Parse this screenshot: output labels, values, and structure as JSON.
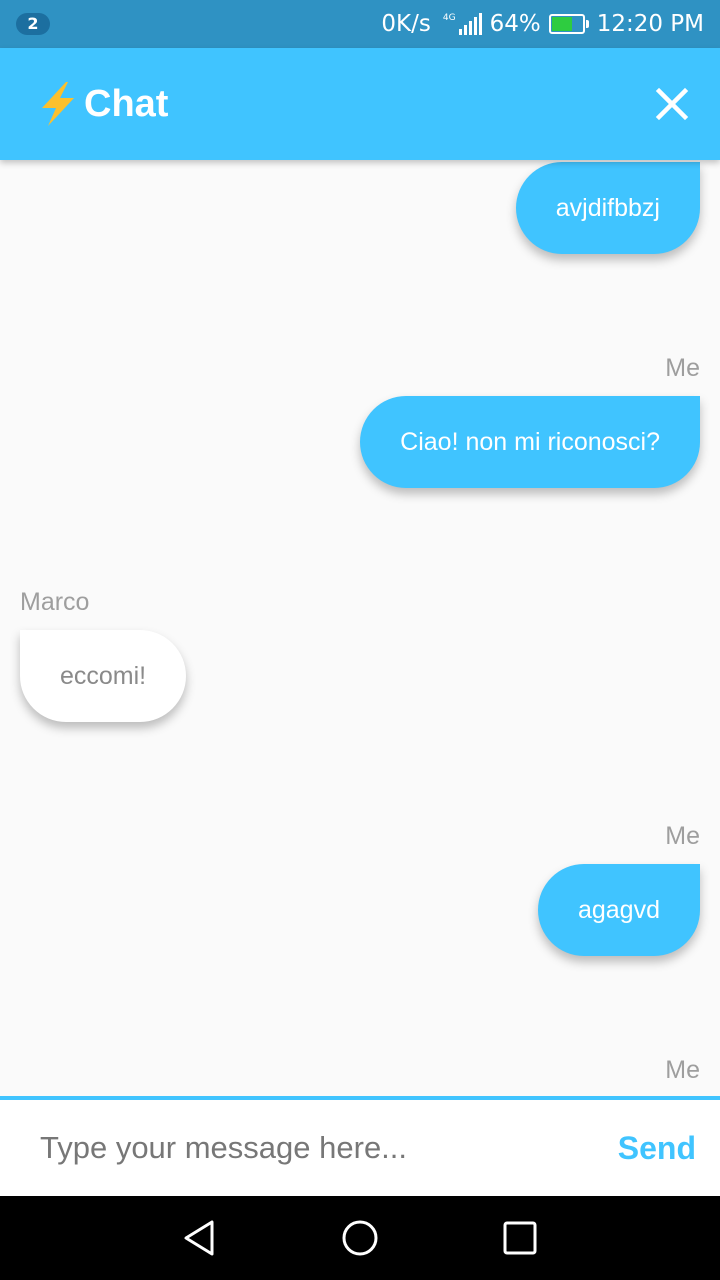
{
  "status_bar": {
    "notification_count": "2",
    "net_speed": "0K/s",
    "network_type": "4G",
    "battery": "64%",
    "time": "12:20 PM",
    "icons": [
      "signal-icon",
      "battery-icon"
    ]
  },
  "app_bar": {
    "title": "Chat",
    "icons": [
      "lightning-bolt-icon",
      "close-icon"
    ],
    "accent_color": "#40c4ff",
    "bolt_color": "#fbc02d"
  },
  "messages": [
    {
      "sender": "",
      "text": "avjdifbbzj",
      "from": "me"
    },
    {
      "sender": "Me",
      "text": "Ciao! non mi riconosci?",
      "from": "me"
    },
    {
      "sender": "Marco",
      "text": "eccomi!",
      "from": "other"
    },
    {
      "sender": "Me",
      "text": "agagvd",
      "from": "me"
    },
    {
      "sender": "Me",
      "text": "",
      "from": "me"
    }
  ],
  "composer": {
    "placeholder": "Type your message here...",
    "value": "",
    "send_label": "Send"
  },
  "nav_bar": {
    "icons": [
      "back-icon",
      "home-icon",
      "recents-icon"
    ]
  }
}
